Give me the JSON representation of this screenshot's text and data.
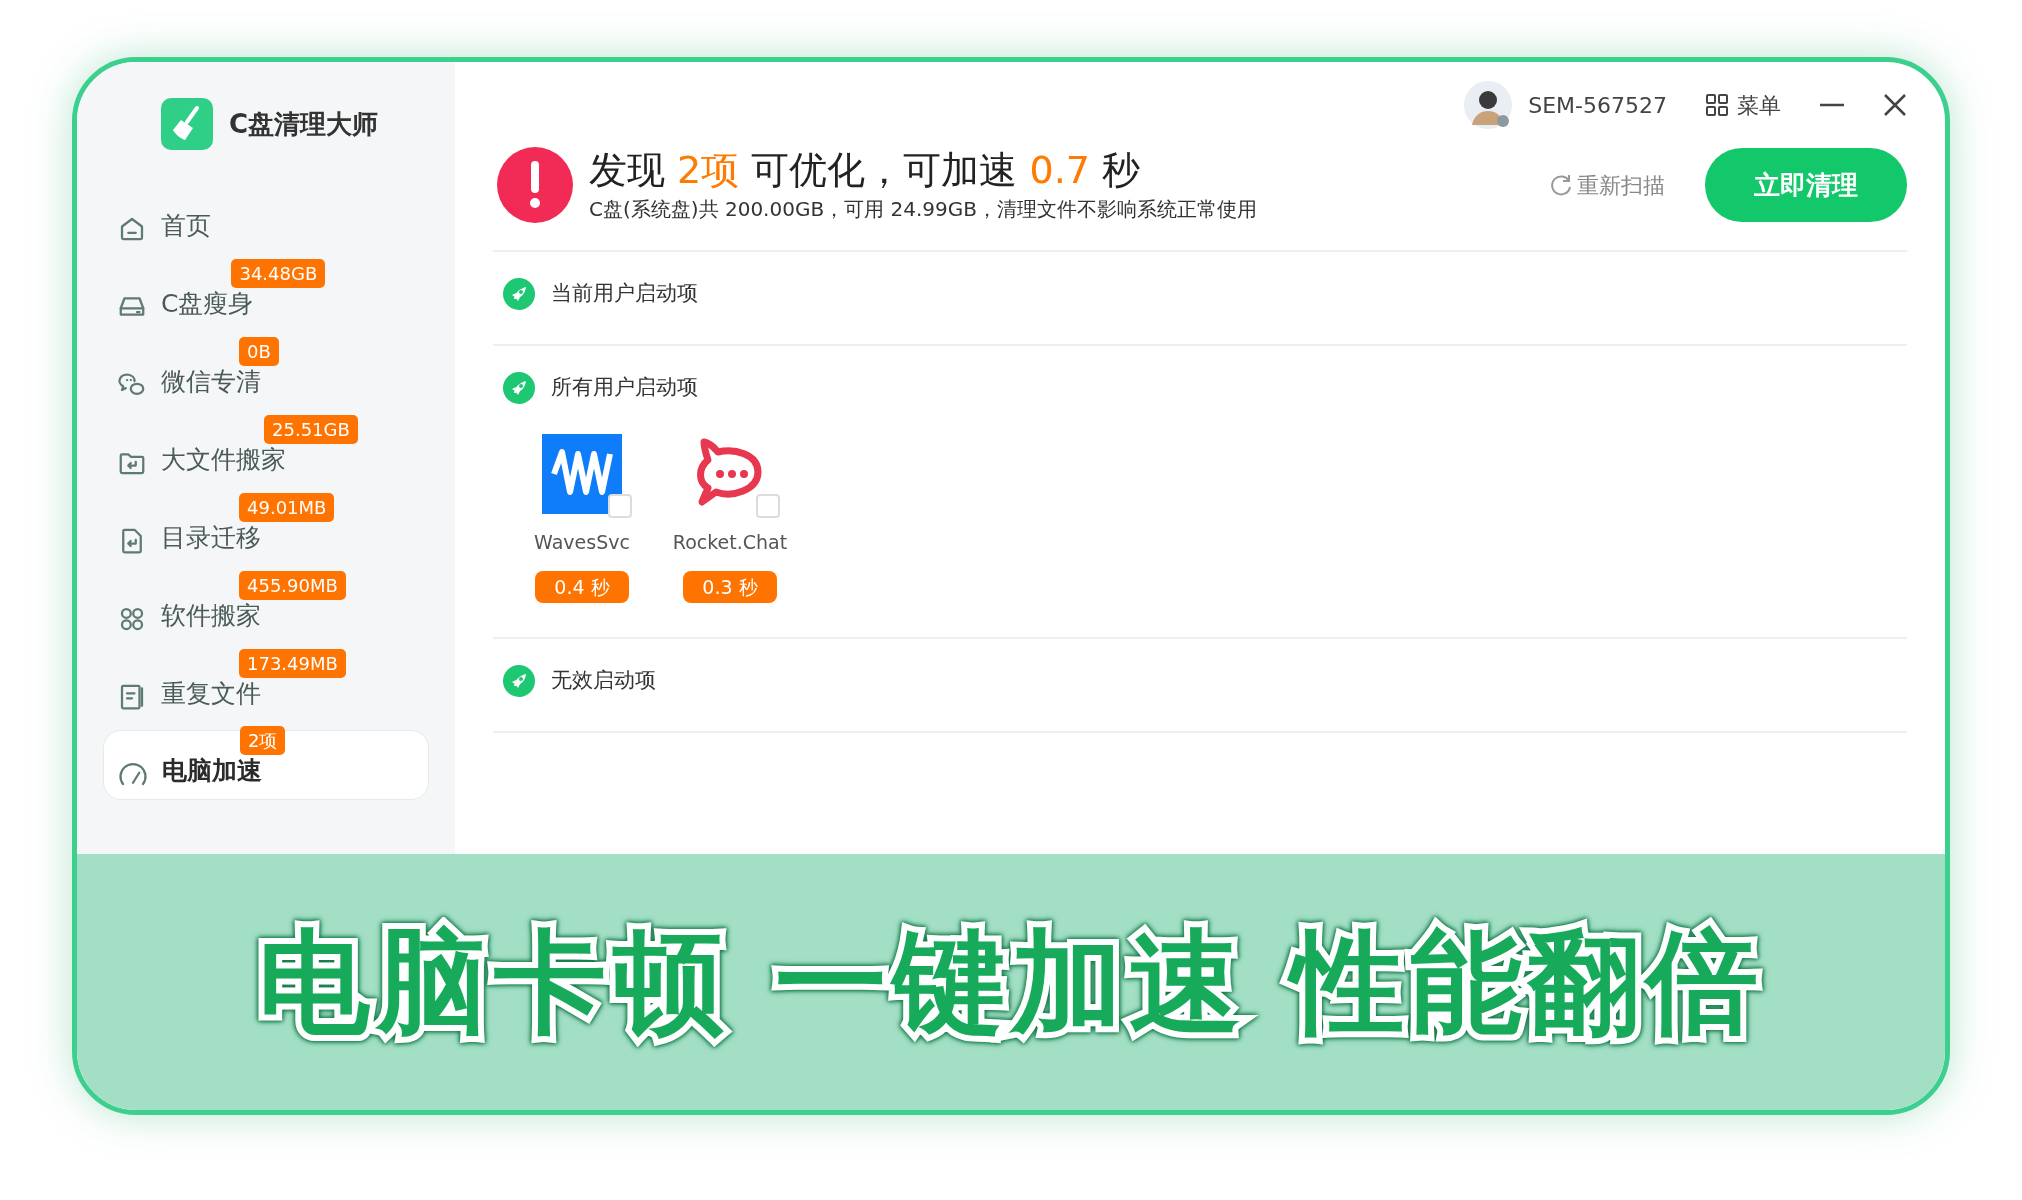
{
  "app": {
    "name": "C盘清理大师"
  },
  "sidebar": {
    "items": [
      {
        "label": "首页",
        "selected": false
      },
      {
        "label": "C盘瘦身",
        "badge": "34.48GB",
        "selected": false
      },
      {
        "label": "微信专清",
        "badge": "0B",
        "selected": false
      },
      {
        "label": "大文件搬家",
        "badge": "25.51GB",
        "selected": false
      },
      {
        "label": "目录迁移",
        "badge": "49.01MB",
        "selected": false
      },
      {
        "label": "软件搬家",
        "badge": "455.90MB",
        "selected": false
      },
      {
        "label": "重复文件",
        "badge": "173.49MB",
        "selected": false
      },
      {
        "label": "电脑加速",
        "badge": "2项",
        "selected": true
      }
    ]
  },
  "topbar": {
    "user": "SEM-567527",
    "menu": "菜单"
  },
  "summary": {
    "title": [
      {
        "text": "发现 ",
        "highlight": false
      },
      {
        "text": "2项",
        "highlight": true
      },
      {
        "text": " 可优化，可加速 ",
        "highlight": false
      },
      {
        "text": "0.7",
        "highlight": true
      },
      {
        "text": " 秒",
        "highlight": false
      }
    ],
    "subtitle": "C盘(系统盘)共 200.00GB，可用 24.99GB，清理文件不影响系统正常使用",
    "rescan": "重新扫描",
    "action": "立即清理"
  },
  "sections": [
    {
      "title": "当前用户启动项"
    },
    {
      "title": "所有用户启动项",
      "apps": [
        {
          "name": "WavesSvc",
          "time": "0.4 秒",
          "checked": false
        },
        {
          "name": "Rocket.Chat",
          "time": "0.3 秒",
          "checked": false
        }
      ]
    },
    {
      "title": "无效启动项"
    }
  ],
  "banner": {
    "slogan": "电脑卡顿 一键加速 性能翻倍"
  }
}
